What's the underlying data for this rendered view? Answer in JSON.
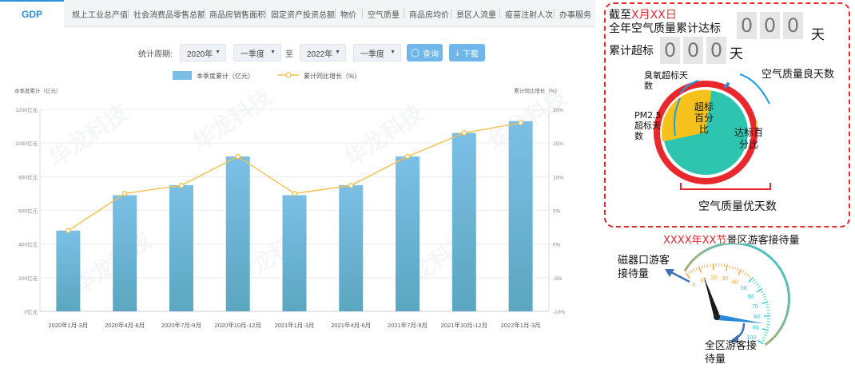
{
  "tabs": {
    "active": "GDP",
    "items": [
      "规上工业总产值",
      "社会消费品零售总额",
      "商品房销售面积",
      "固定资产投资总额",
      "物价",
      "空气质量",
      "商品房均价",
      "景区人流量",
      "疫苗注射人次",
      "办事服务"
    ]
  },
  "filters": {
    "period_label": "统计周期:",
    "start_year": "2020年",
    "start_quarter": "一季度",
    "to_label": "至",
    "end_year": "2022年",
    "end_quarter": "一季度",
    "query_label": "查询",
    "download_label": "下载"
  },
  "watermark": "华龙科技",
  "chart_data": {
    "type": "bar",
    "categories": [
      "2020年1月-3月",
      "2020年4月-6月",
      "2020年7月-9月",
      "2020年10月-12月",
      "2021年1月-3月",
      "2021年4月-6月",
      "2021年7月-9月",
      "2021年10月-12月",
      "2022年1月-3月"
    ],
    "series": [
      {
        "name": "本季度累计（亿元）",
        "type": "bar",
        "axis": "left",
        "values": [
          480,
          690,
          750,
          920,
          690,
          750,
          920,
          1060,
          1130
        ]
      },
      {
        "name": "累计同比增长（%）",
        "type": "line",
        "axis": "right",
        "values": [
          2,
          7.5,
          8.7,
          13,
          7.5,
          8.7,
          13,
          16.5,
          18
        ]
      }
    ],
    "ylabel": "本季度累计（亿元）",
    "y2label": "累计同比增长（%）",
    "ylim": [
      0,
      1200
    ],
    "y2lim": [
      -10,
      20
    ],
    "yticks": [
      "0亿元",
      "200亿元",
      "400亿元",
      "600亿元",
      "800亿元",
      "1000亿元",
      "1200亿元"
    ],
    "y2ticks": [
      "-10%",
      "-5%",
      "0%",
      "5%",
      "10%",
      "15%",
      "20%"
    ],
    "legend": "top-center",
    "grid": true,
    "colors": {
      "bar_top": "#7bbfe6",
      "bar_bottom": "#5ba6c0",
      "line": "#f5c04a"
    }
  },
  "air_quality": {
    "line1_prefix": "截至",
    "line1_highlight": "X月XX日",
    "line2": "全年空气质量累计达标",
    "digits_top": [
      "0",
      "0",
      "0"
    ],
    "unit_top": "天",
    "line3": "累计超标",
    "digits_bottom": [
      "0",
      "0",
      "0"
    ],
    "unit_bottom": "天",
    "label_ozone": "臭氧超标天数",
    "label_good": "空气质量良天数",
    "label_pm25": "PM2.5超标天数",
    "label_excellent": "空气质量优天数",
    "inner_exceed": "超标百分比",
    "inner_standard": "达标百分比",
    "colors": {
      "ring": "#e8282c",
      "inner_standard": "#2ec5b0",
      "inner_exceed": "#f5c21b",
      "bracket": "#1a9ee8",
      "highlight": "#e8282c"
    }
  },
  "gauge": {
    "title_highlight1": "XXXX年XX节",
    "title_rest": "景区游客接待量",
    "label_entrance": "磁器口游客接待量",
    "label_total": "全区游客接待量",
    "ticks": [
      "0",
      "10",
      "20",
      "30",
      "40",
      "50",
      "60",
      "70",
      "80",
      "90",
      "100"
    ],
    "colors": {
      "arc_start": "#f3a23a",
      "arc_end": "#2ec7d6",
      "needle": "#1a1a1a",
      "needle2": "#2a8ad9",
      "arrow": "#3e6fb8"
    }
  }
}
